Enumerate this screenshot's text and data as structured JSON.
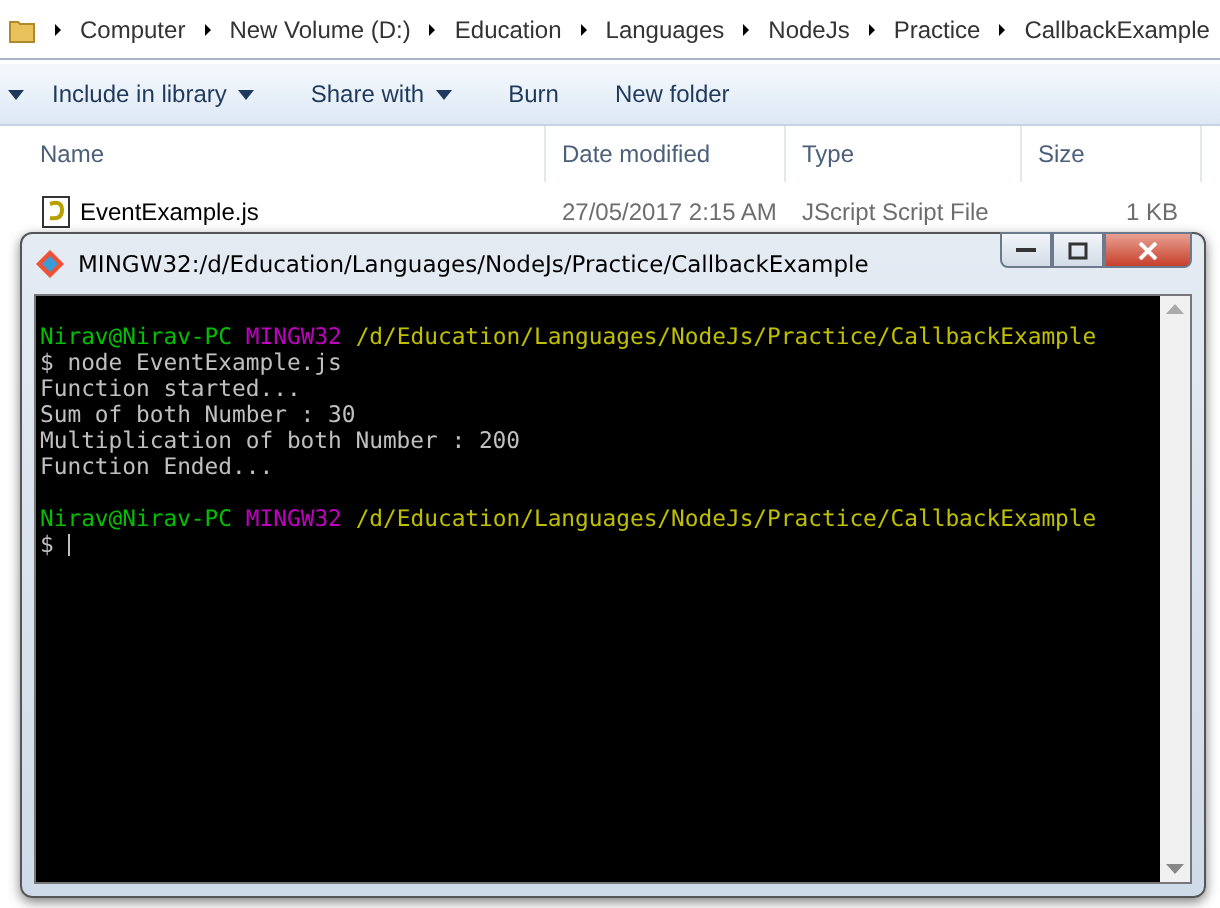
{
  "explorer": {
    "breadcrumbs": [
      "Computer",
      "New Volume (D:)",
      "Education",
      "Languages",
      "NodeJs",
      "Practice",
      "CallbackExample"
    ],
    "toolbar": [
      {
        "label": "Include in library",
        "dropdown": true
      },
      {
        "label": "Share with",
        "dropdown": true
      },
      {
        "label": "Burn",
        "dropdown": false
      },
      {
        "label": "New folder",
        "dropdown": false
      }
    ],
    "columns": [
      "Name",
      "Date modified",
      "Type",
      "Size"
    ],
    "files": [
      {
        "name": "EventExample.js",
        "date": "27/05/2017 2:15 AM",
        "type": "JScript Script File",
        "size": "1 KB"
      }
    ]
  },
  "terminal": {
    "title": "MINGW32:/d/Education/Languages/NodeJs/Practice/CallbackExample",
    "lines": [
      {
        "kind": "text",
        "segments": [
          {
            "kind": "user",
            "text": "Nirav@Nirav-PC"
          },
          {
            "kind": "host",
            "text": "MINGW32"
          },
          {
            "kind": "path",
            "text": "/d/Education/Languages/NodeJs/Practice/CallbackExample"
          }
        ]
      },
      {
        "kind": "text",
        "segments": [
          {
            "kind": "plain",
            "text": "$ node EventExample.js"
          }
        ]
      },
      {
        "kind": "text",
        "segments": [
          {
            "kind": "plain",
            "text": "Function started..."
          }
        ]
      },
      {
        "kind": "text",
        "segments": [
          {
            "kind": "plain",
            "text": "Sum of both Number : 30"
          }
        ]
      },
      {
        "kind": "text",
        "segments": [
          {
            "kind": "plain",
            "text": "Multiplication of both Number : 200"
          }
        ]
      },
      {
        "kind": "text",
        "segments": [
          {
            "kind": "plain",
            "text": "Function Ended..."
          }
        ]
      },
      {
        "kind": "blank"
      },
      {
        "kind": "text",
        "segments": [
          {
            "kind": "user",
            "text": "Nirav@Nirav-PC"
          },
          {
            "kind": "host",
            "text": "MINGW32"
          },
          {
            "kind": "path",
            "text": "/d/Education/Languages/NodeJs/Practice/CallbackExample"
          }
        ]
      },
      {
        "kind": "text",
        "segments": [
          {
            "kind": "plain",
            "text": "$"
          },
          {
            "kind": "cursor"
          }
        ]
      }
    ]
  }
}
